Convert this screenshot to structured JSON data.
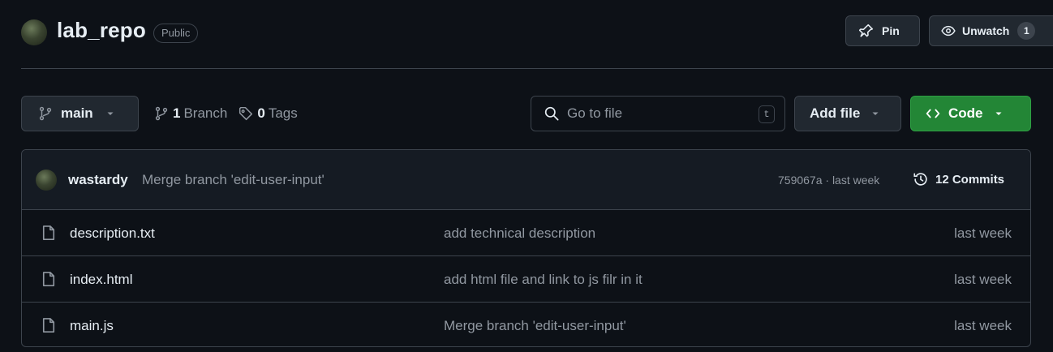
{
  "repo": {
    "name": "lab_repo",
    "visibility": "Public"
  },
  "header_actions": {
    "pin_label": "Pin",
    "unwatch_label": "Unwatch",
    "watch_count": "1"
  },
  "toolbar": {
    "branch": "main",
    "branch_count": "1",
    "branch_label": "Branch",
    "tag_count": "0",
    "tag_label": "Tags",
    "search_placeholder": "Go to file",
    "search_shortcut": "t",
    "add_file_label": "Add file",
    "code_label": "Code"
  },
  "latest_commit": {
    "author": "wastardy",
    "message": "Merge branch 'edit-user-input'",
    "hash_and_time": "759067a · last week",
    "commits_count_label": "12 Commits"
  },
  "files": [
    {
      "name": "description.txt",
      "message": "add technical description",
      "time": "last week"
    },
    {
      "name": "index.html",
      "message": "add html file and link to js filr in it",
      "time": "last week"
    },
    {
      "name": "main.js",
      "message": "Merge branch 'edit-user-input'",
      "time": "last week"
    }
  ],
  "colors": {
    "background": "#0d1117",
    "border": "#3d444d",
    "muted_text": "#9198a1",
    "primary_green": "#238636"
  }
}
